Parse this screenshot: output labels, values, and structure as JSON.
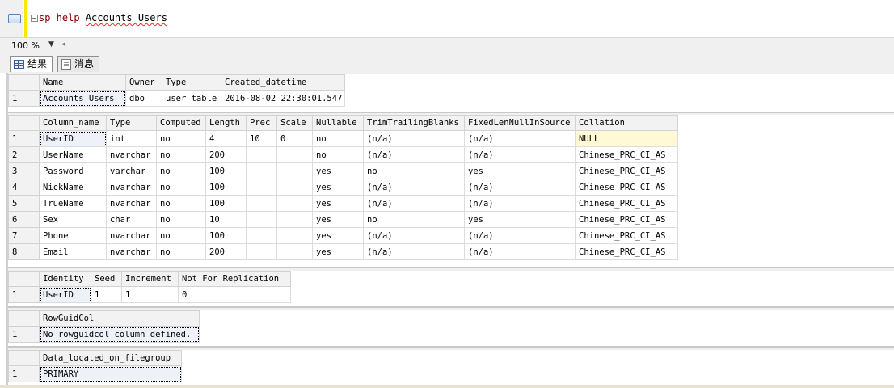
{
  "editor": {
    "collapse_glyph": "−",
    "keyword": "sp_help",
    "identifier": "Accounts_Users"
  },
  "zoom": {
    "value": "100 %",
    "dropdown_glyph": "▼",
    "scroll_glyph": "◂"
  },
  "tabs": [
    {
      "label": "结果",
      "icon": "grid-icon"
    },
    {
      "label": "消息",
      "icon": "messages-icon"
    }
  ],
  "grids": [
    {
      "name": "object-info",
      "columns": [
        "Name",
        "Owner",
        "Type",
        "Created_datetime"
      ],
      "rows": [
        [
          "Accounts_Users",
          "dbo",
          "user table",
          "2016-08-02 22:30:01.547"
        ]
      ]
    },
    {
      "name": "columns-info",
      "columns": [
        "Column_name",
        "Type",
        "Computed",
        "Length",
        "Prec",
        "Scale",
        "Nullable",
        "TrimTrailingBlanks",
        "FixedLenNullInSource",
        "Collation"
      ],
      "rows": [
        [
          "UserID",
          "int",
          "no",
          "4",
          "10",
          "0",
          "no",
          "(n/a)",
          "(n/a)",
          "NULL"
        ],
        [
          "UserName",
          "nvarchar",
          "no",
          "200",
          "",
          "",
          "no",
          "(n/a)",
          "(n/a)",
          "Chinese_PRC_CI_AS"
        ],
        [
          "Password",
          "varchar",
          "no",
          "100",
          "",
          "",
          "yes",
          "no",
          "yes",
          "Chinese_PRC_CI_AS"
        ],
        [
          "NickName",
          "nvarchar",
          "no",
          "100",
          "",
          "",
          "yes",
          "(n/a)",
          "(n/a)",
          "Chinese_PRC_CI_AS"
        ],
        [
          "TrueName",
          "nvarchar",
          "no",
          "100",
          "",
          "",
          "yes",
          "(n/a)",
          "(n/a)",
          "Chinese_PRC_CI_AS"
        ],
        [
          "Sex",
          "char",
          "no",
          "10",
          "",
          "",
          "yes",
          "no",
          "yes",
          "Chinese_PRC_CI_AS"
        ],
        [
          "Phone",
          "nvarchar",
          "no",
          "100",
          "",
          "",
          "yes",
          "(n/a)",
          "(n/a)",
          "Chinese_PRC_CI_AS"
        ],
        [
          "Email",
          "nvarchar",
          "no",
          "200",
          "",
          "",
          "yes",
          "(n/a)",
          "(n/a)",
          "Chinese_PRC_CI_AS"
        ]
      ]
    },
    {
      "name": "identity-info",
      "columns": [
        "Identity",
        "Seed",
        "Increment",
        "Not For Replication"
      ],
      "rows": [
        [
          "UserID",
          "1",
          "1",
          "0"
        ]
      ]
    },
    {
      "name": "rowguidcol-info",
      "columns": [
        "RowGuidCol"
      ],
      "rows": [
        [
          "No rowguidcol column defined."
        ]
      ]
    },
    {
      "name": "filegroup-info",
      "columns": [
        "Data_located_on_filegroup"
      ],
      "rows": [
        [
          "PRIMARY"
        ]
      ]
    }
  ]
}
